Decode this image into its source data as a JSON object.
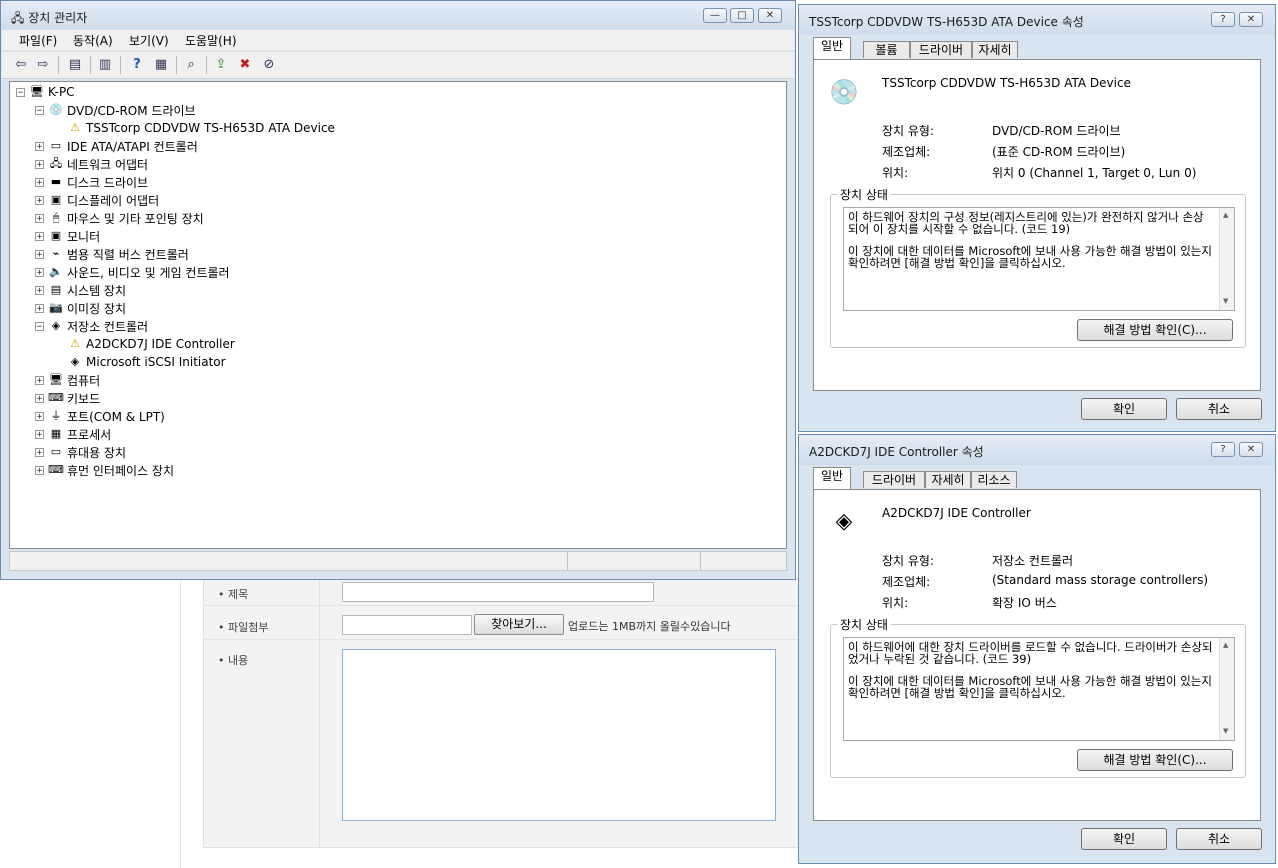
{
  "webform": {
    "subject_label": "• 제목",
    "attach_label": "• 파일첨부",
    "browse_button": "찾아보기...",
    "upload_note": "업로드는 1MB까지 올릴수있습니다",
    "content_label": "• 내용"
  },
  "device_manager": {
    "title": "장치 관리자",
    "menu": [
      "파일(F)",
      "동작(A)",
      "보기(V)",
      "도움말(H)"
    ],
    "tree": [
      {
        "label": "K-PC",
        "level": 0,
        "expander": "−",
        "icon": "computer-icon",
        "glyph": "🖥"
      },
      {
        "label": "DVD/CD-ROM 드라이브",
        "level": 1,
        "expander": "−",
        "icon": "dvd-drive-icon",
        "glyph": "💿"
      },
      {
        "label": "TSSTcorp CDDVDW TS-H653D ATA Device",
        "level": 2,
        "expander": "",
        "icon": "warning-device-icon",
        "glyph": "⚠"
      },
      {
        "label": "IDE ATA/ATAPI 컨트롤러",
        "level": 1,
        "expander": "+",
        "icon": "ide-controller-icon",
        "glyph": "▭"
      },
      {
        "label": "네트워크 어댑터",
        "level": 1,
        "expander": "+",
        "icon": "network-adapter-icon",
        "glyph": "🖧"
      },
      {
        "label": "디스크 드라이브",
        "level": 1,
        "expander": "+",
        "icon": "disk-drive-icon",
        "glyph": "▬"
      },
      {
        "label": "디스플레이 어댑터",
        "level": 1,
        "expander": "+",
        "icon": "display-adapter-icon",
        "glyph": "▣"
      },
      {
        "label": "마우스 및 기타 포인팅 장치",
        "level": 1,
        "expander": "+",
        "icon": "mouse-icon",
        "glyph": "🖱"
      },
      {
        "label": "모니터",
        "level": 1,
        "expander": "+",
        "icon": "monitor-icon",
        "glyph": "▣"
      },
      {
        "label": "범용 직렬 버스 컨트롤러",
        "level": 1,
        "expander": "+",
        "icon": "usb-icon",
        "glyph": "⌁"
      },
      {
        "label": "사운드, 비디오 및 게임 컨트롤러",
        "level": 1,
        "expander": "+",
        "icon": "speaker-icon",
        "glyph": "🔈"
      },
      {
        "label": "시스템 장치",
        "level": 1,
        "expander": "+",
        "icon": "system-device-icon",
        "glyph": "▤"
      },
      {
        "label": "이미징 장치",
        "level": 1,
        "expander": "+",
        "icon": "imaging-device-icon",
        "glyph": "📷"
      },
      {
        "label": "저장소 컨트롤러",
        "level": 1,
        "expander": "−",
        "icon": "storage-controller-icon",
        "glyph": "◈"
      },
      {
        "label": "A2DCKD7J IDE Controller",
        "level": 2,
        "expander": "",
        "icon": "warning-controller-icon",
        "glyph": "⚠"
      },
      {
        "label": "Microsoft iSCSI Initiator",
        "level": 2,
        "expander": "",
        "icon": "storage-controller-icon",
        "glyph": "◈"
      },
      {
        "label": "컴퓨터",
        "level": 1,
        "expander": "+",
        "icon": "computer-icon",
        "glyph": "🖥"
      },
      {
        "label": "키보드",
        "level": 1,
        "expander": "+",
        "icon": "keyboard-icon",
        "glyph": "⌨"
      },
      {
        "label": "포트(COM & LPT)",
        "level": 1,
        "expander": "+",
        "icon": "port-icon",
        "glyph": "⏚"
      },
      {
        "label": "프로세서",
        "level": 1,
        "expander": "+",
        "icon": "processor-icon",
        "glyph": "▦"
      },
      {
        "label": "휴대용 장치",
        "level": 1,
        "expander": "+",
        "icon": "portable-device-icon",
        "glyph": "▭"
      },
      {
        "label": "휴먼 인터페이스 장치",
        "level": 1,
        "expander": "+",
        "icon": "hid-icon",
        "glyph": "⌨"
      }
    ]
  },
  "dialog1": {
    "title": "TSSTcorp CDDVDW TS-H653D ATA Device 속성",
    "tabs": [
      "일반",
      "볼륨",
      "드라이버",
      "자세히"
    ],
    "device_name": "TSSTcorp CDDVDW TS-H653D ATA Device",
    "props": [
      {
        "label": "장치 유형:",
        "value": "DVD/CD-ROM 드라이브"
      },
      {
        "label": "제조업체:",
        "value": "(표준 CD-ROM 드라이브)"
      },
      {
        "label": "위치:",
        "value": "위치 0 (Channel 1, Target 0, Lun 0)"
      }
    ],
    "status_title": "장치 상태",
    "status_p1": "이 하드웨어 장치의 구성 정보(레지스트리에 있는)가 완전하지 않거나 손상되어 이 장치를 시작할 수 없습니다. (코드 19)",
    "status_p2": "이 장치에 대한 데이터를 Microsoft에 보내 사용 가능한 해결 방법이 있는지 확인하려면 [해결 방법 확인]을 클릭하십시오.",
    "solution_button": "해결 방법 확인(C)...",
    "ok": "확인",
    "cancel": "취소"
  },
  "dialog2": {
    "title": "A2DCKD7J IDE Controller 속성",
    "tabs": [
      "일반",
      "드라이버",
      "자세히",
      "리소스"
    ],
    "device_name": "A2DCKD7J IDE Controller",
    "props": [
      {
        "label": "장치 유형:",
        "value": "저장소 컨트롤러"
      },
      {
        "label": "제조업체:",
        "value": "(Standard mass storage controllers)"
      },
      {
        "label": "위치:",
        "value": "확장 IO 버스"
      }
    ],
    "status_title": "장치 상태",
    "status_p1": "이 하드웨어에 대한 장치 드라이버를 로드할 수 없습니다. 드라이버가 손상되었거나 누락된 것 같습니다. (코드 39)",
    "status_p2": "이 장치에 대한 데이터를 Microsoft에 보내 사용 가능한 해결 방법이 있는지 확인하려면 [해결 방법 확인]을 클릭하십시오.",
    "solution_button": "해결 방법 확인(C)...",
    "ok": "확인",
    "cancel": "취소"
  }
}
